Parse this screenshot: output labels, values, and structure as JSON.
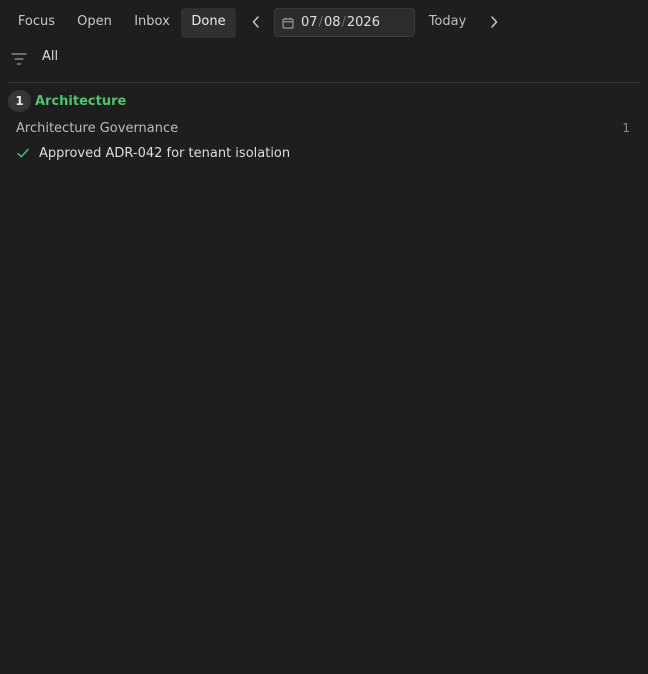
{
  "tabs": [
    {
      "label": "Focus",
      "active": false
    },
    {
      "label": "Open",
      "active": false
    },
    {
      "label": "Inbox",
      "active": false
    },
    {
      "label": "Done",
      "active": true
    }
  ],
  "date": {
    "month": "07",
    "day": "08",
    "year": "2026",
    "separator": "/"
  },
  "nav": {
    "prev_icon": "chevron-left-icon",
    "next_icon": "chevron-right-icon",
    "calendar_icon": "calendar-icon"
  },
  "today_label": "Today",
  "filter": {
    "icon": "filter-icon",
    "label": "All"
  },
  "groups": [
    {
      "count": "1",
      "title": "Architecture",
      "subgroups": [
        {
          "name": "Architecture Governance",
          "count": "1",
          "tasks": [
            {
              "label": "Approved ADR-042 for tenant isolation",
              "done": true
            }
          ]
        }
      ]
    }
  ],
  "colors": {
    "background": "#1e1e1e",
    "group_title": "#4ec36a",
    "check": "#4ec36a",
    "active_tab_bg": "#303030"
  }
}
